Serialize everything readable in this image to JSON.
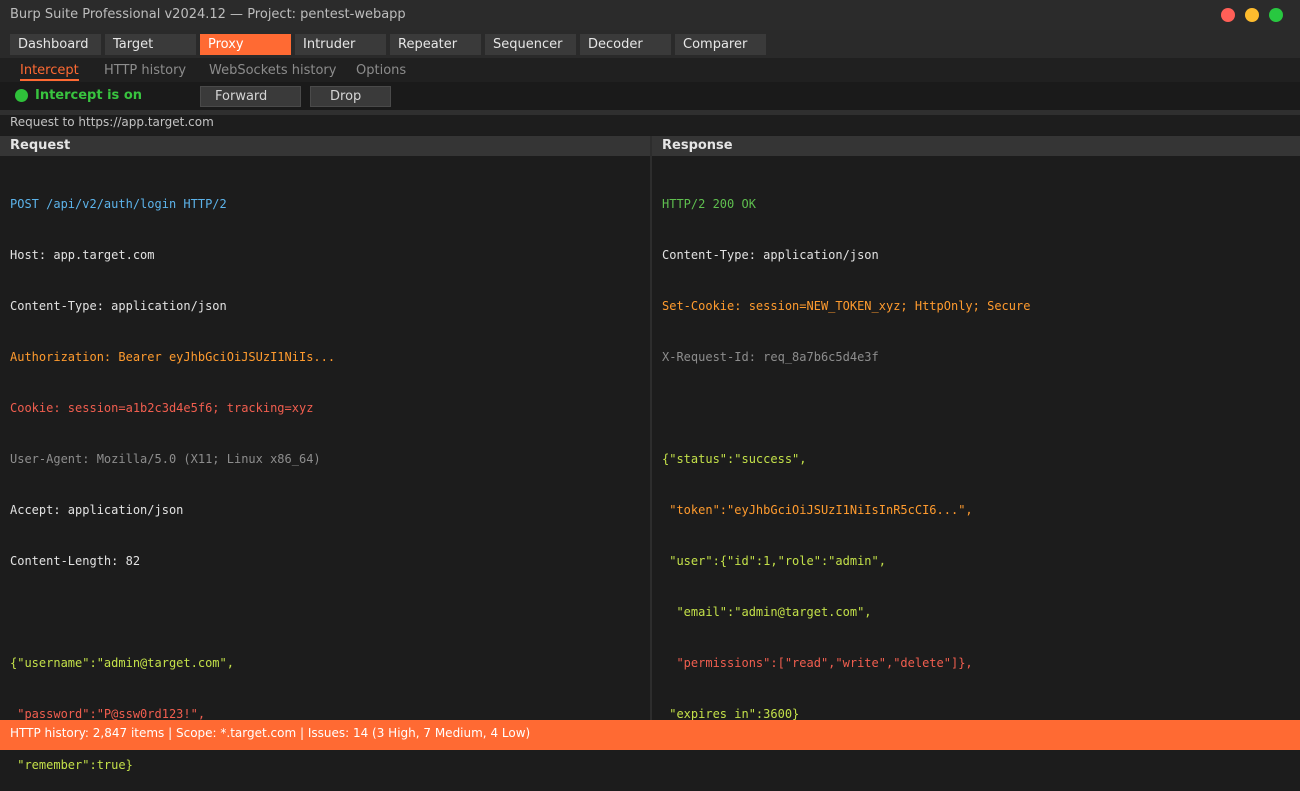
{
  "window": {
    "title": "Burp Suite Professional v2024.12 — Project: pentest-webapp",
    "controls": [
      {
        "name": "close",
        "color": "#ff5f57"
      },
      {
        "name": "minimize",
        "color": "#febc2e"
      },
      {
        "name": "maximize",
        "color": "#28c840"
      }
    ]
  },
  "main_tabs": [
    "Dashboard",
    "Target",
    "Proxy",
    "Intruder",
    "Repeater",
    "Sequencer",
    "Decoder",
    "Comparer"
  ],
  "active_main_tab": "Proxy",
  "sub_tabs": [
    "Intercept",
    "HTTP history",
    "WebSockets history",
    "Options"
  ],
  "active_sub_tab": "Intercept",
  "intercept": {
    "status": "Intercept is on",
    "forward_label": "Forward",
    "drop_label": "Drop"
  },
  "request_to": "Request to https://app.target.com",
  "request": {
    "title": "Request",
    "lines": [
      "POST /api/v2/auth/login HTTP/2",
      "Host: app.target.com",
      "Content-Type: application/json",
      "Authorization: Bearer eyJhbGciOiJSUzI1NiIs...",
      "Cookie: session=a1b2c3d4e5f6; tracking=xyz",
      "User-Agent: Mozilla/5.0 (X11; Linux x86_64)",
      "Accept: application/json",
      "Content-Length: 82",
      "",
      "{\"username\":\"admin@target.com\",",
      " \"password\":\"P@ssw0rd123!\",",
      " \"remember\":true}"
    ]
  },
  "response": {
    "title": "Response",
    "lines": [
      "HTTP/2 200 OK",
      "Content-Type: application/json",
      "Set-Cookie: session=NEW_TOKEN_xyz; HttpOnly; Secure",
      "X-Request-Id: req_8a7b6c5d4e3f",
      "",
      "{\"status\":\"success\",",
      " \"token\":\"eyJhbGciOiJSUzI1NiIsInR5cCI6...\",",
      " \"user\":{\"id\":1,\"role\":\"admin\",",
      "  \"email\":\"admin@target.com\",",
      "  \"permissions\":[\"read\",\"write\",\"delete\"]},",
      " \"expires_in\":3600}"
    ]
  },
  "status_bar": "HTTP history: 2,847 items  |  Scope: *.target.com  |  Issues: 14 (3 High, 7 Medium, 4 Low)",
  "colors": {
    "accent": "#ff6a33",
    "intercept_on": "#2fc13a",
    "method_line": "#5cb3ea",
    "sensitive_header": "#ff9b2e",
    "secret_value": "#f15e4f",
    "json_body": "#c3e049"
  }
}
